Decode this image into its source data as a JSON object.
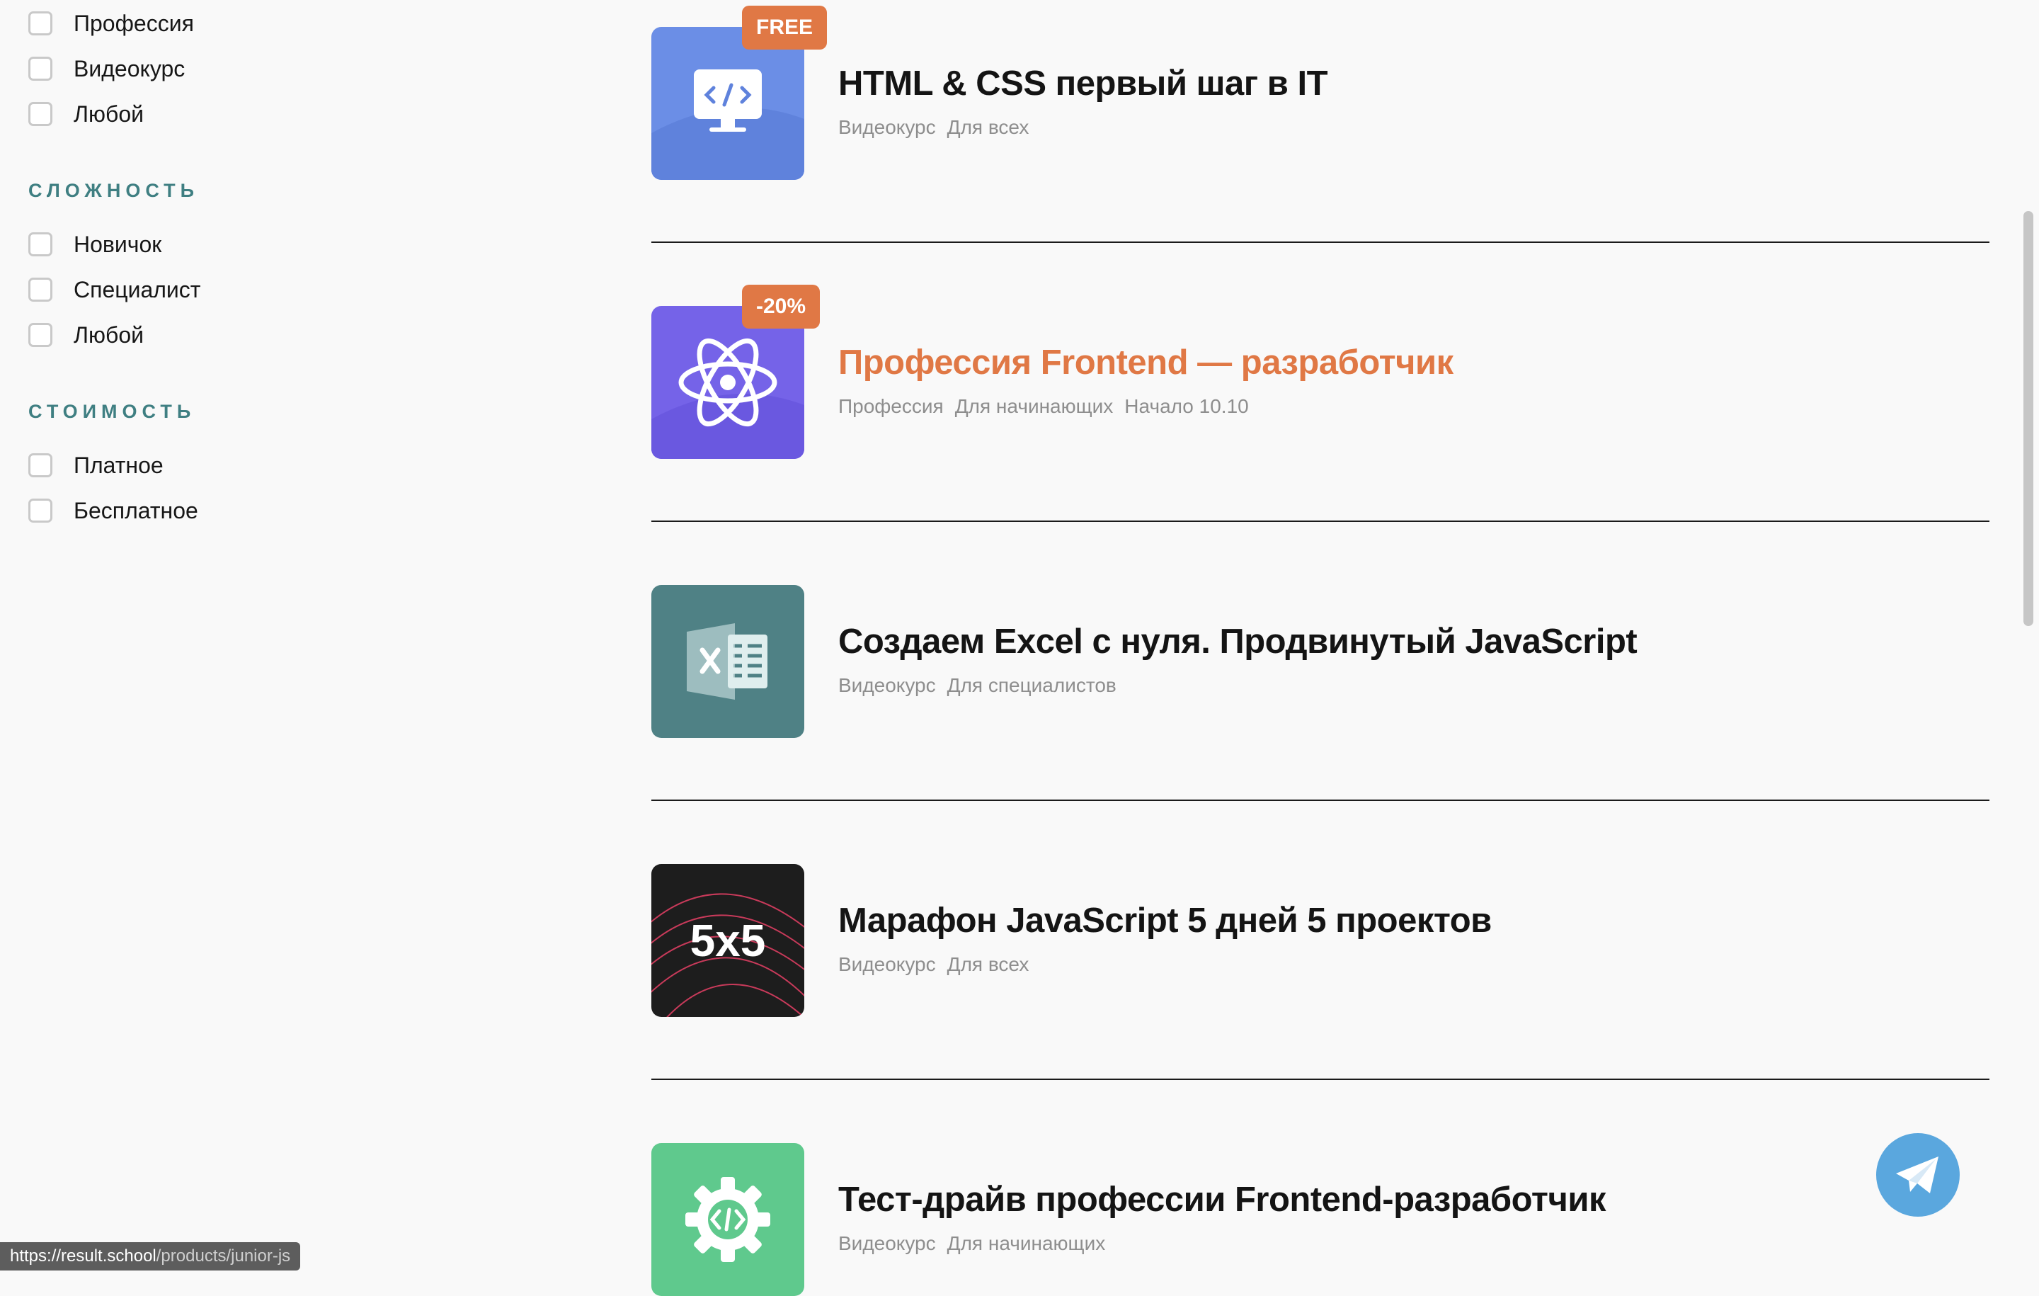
{
  "filters": {
    "type_items": [
      "Профессия",
      "Видеокурс",
      "Любой"
    ],
    "difficulty": {
      "title": "СЛОЖНОСТЬ",
      "items": [
        "Новичок",
        "Специалист",
        "Любой"
      ]
    },
    "price": {
      "title": "СТОИМОСТЬ",
      "items": [
        "Платное",
        "Бесплатное"
      ]
    }
  },
  "courses": [
    {
      "title": "HTML & CSS первый шаг в IT",
      "badge": "FREE",
      "tags": [
        "Видеокурс",
        "Для всех"
      ],
      "icon": "monitor-code-icon",
      "color": "#6b8ee6"
    },
    {
      "title": "Профессия Frontend — разработчик",
      "badge": "-20%",
      "tags": [
        "Профессия",
        "Для начинающих",
        "Начало 10.10"
      ],
      "icon": "react-atom-icon",
      "color": "#7563e8",
      "accent_color": "#e07845"
    },
    {
      "title": "Создаем Excel с нуля. Продвинутый JavaScript",
      "tags": [
        "Видеокурс",
        "Для специалистов"
      ],
      "icon": "excel-icon",
      "color": "#4f8185"
    },
    {
      "title": "Марафон JavaScript 5 дней 5 проектов",
      "thumb_text": "5x5",
      "tags": [
        "Видеокурс",
        "Для всех"
      ],
      "icon": "marathon-5x5-icon",
      "color": "#1d1d1d"
    },
    {
      "title": "Тест-драйв профессии Frontend-разработчик",
      "tags": [
        "Видеокурс",
        "Для начинающих"
      ],
      "icon": "gear-code-icon",
      "color": "#5fc98d"
    }
  ],
  "status_bar": {
    "url_host": "https://result.school",
    "url_path": "/products/junior-js"
  },
  "telegram": {
    "icon": "telegram-icon",
    "color": "#5aa7de"
  }
}
